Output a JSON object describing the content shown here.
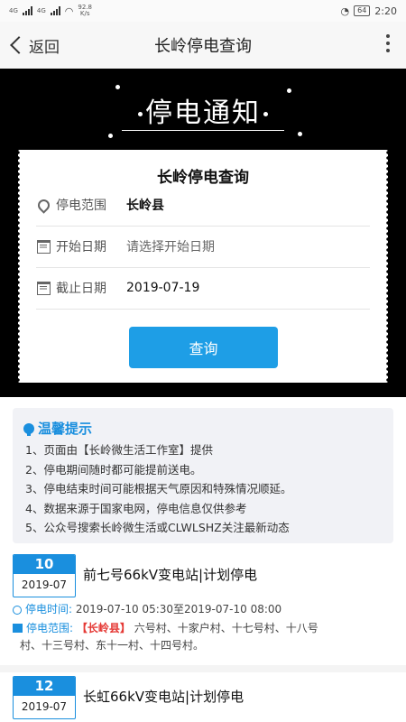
{
  "statusbar": {
    "sim1": "4G",
    "sim2": "4G",
    "net_speed": "92.8",
    "net_unit": "K/s",
    "battery": "64",
    "time": "2:20"
  },
  "navbar": {
    "back_label": "返回",
    "title": "长岭停电查询"
  },
  "banner": {
    "title": "停电通知"
  },
  "form": {
    "title": "长岭停电查询",
    "area_label": "停电范围",
    "area_value": "长岭县",
    "start_label": "开始日期",
    "start_placeholder": "请选择开始日期",
    "end_label": "截止日期",
    "end_value": "2019-07-19",
    "query_button": "查询"
  },
  "tips": {
    "title": "温馨提示",
    "items": [
      "1、页面由【长岭微生活工作室】提供",
      "2、停电期间随时都可能提前送电。",
      "3、停电结束时间可能根据天气原因和特殊情况顺延。",
      "4、数据来源于国家电网，停电信息仅供参考",
      "5、公众号搜索长岭微生活或CLWLSHZ关注最新动态"
    ]
  },
  "outages": [
    {
      "day": "10",
      "year_month": "2019-07",
      "title": "前七号66kV变电站|计划停电",
      "time_label": "停电时间:",
      "time_value": "2019-07-10 05:30至2019-07-10 08:00",
      "area_label": "停电范围:",
      "county": "【长岭县】",
      "villages_line1": " 六号村、十家户村、十七号村、十八号",
      "villages_line2": "村、十三号村、东十一村、十四号村。"
    },
    {
      "day": "12",
      "year_month": "2019-07",
      "title": "长虹66kV变电站|计划停电"
    }
  ],
  "colors": {
    "accent": "#1a8fde",
    "button": "#1e9ee6",
    "county": "#e53935"
  }
}
